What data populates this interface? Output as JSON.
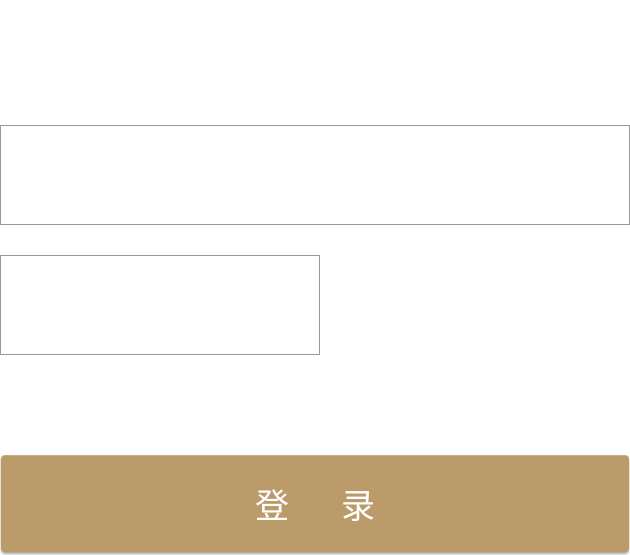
{
  "form": {
    "username_field": {
      "value": "",
      "placeholder": ""
    },
    "code_field": {
      "value": "",
      "placeholder": ""
    },
    "login_button_label": "登录"
  },
  "colors": {
    "button_background": "#bb9b69",
    "button_text": "#ffffff",
    "field_border": "#9a9a9a"
  }
}
